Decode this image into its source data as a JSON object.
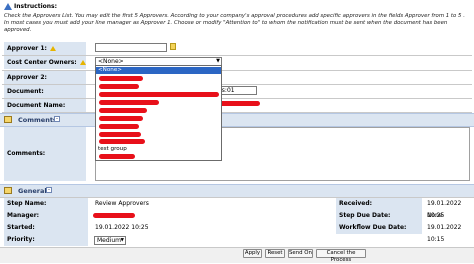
{
  "instructions": {
    "title": "Instructions:",
    "text": "Check the Approvers List. You may edit the first 5 Approvers. According to your company's approval procedures add specific approvers in the fields Approver from 1 to 5 . In most cases you must add your line manager as Approver 1. Choose or modify \"Attention to\" to whom the notification must be sent when the document has been approved."
  },
  "form": {
    "approver1_label": "Approver 1:",
    "cost_center_owners_label": "Cost Center Owners:",
    "approver2_label": "Approver 2:",
    "document_label": "Document:",
    "document_name_label": "Document Name:",
    "cost_center_selected": "<None>",
    "document_value_suffix": "ns:01"
  },
  "dropdown": {
    "items": [
      "<None>",
      "test group"
    ]
  },
  "comments": {
    "section_title": "Comments",
    "label": "Comments:"
  },
  "general": {
    "section_title": "General",
    "step_name_label": "Step Name:",
    "step_name_value": "Review Approvers",
    "received_label": "Received:",
    "received_value": "19.01.2022 10:25",
    "manager_label": "Manager:",
    "step_due_date_label": "Step Due Date:",
    "step_due_date_value": "None",
    "started_label": "Started:",
    "started_value": "19.01.2022 10:25",
    "workflow_due_date_label": "Workflow Due Date:",
    "workflow_due_date_value": "19.01.2022 10:15",
    "priority_label": "Priority:",
    "priority_value": "Medium"
  },
  "buttons": {
    "apply": "Apply",
    "reset": "Reset",
    "send_on": "Send On",
    "cancel_process": "Cancel the Process"
  },
  "colors": {
    "label_bg": "#dbe5f1",
    "selection": "#2b66c4",
    "redaction": "#e8101a"
  }
}
